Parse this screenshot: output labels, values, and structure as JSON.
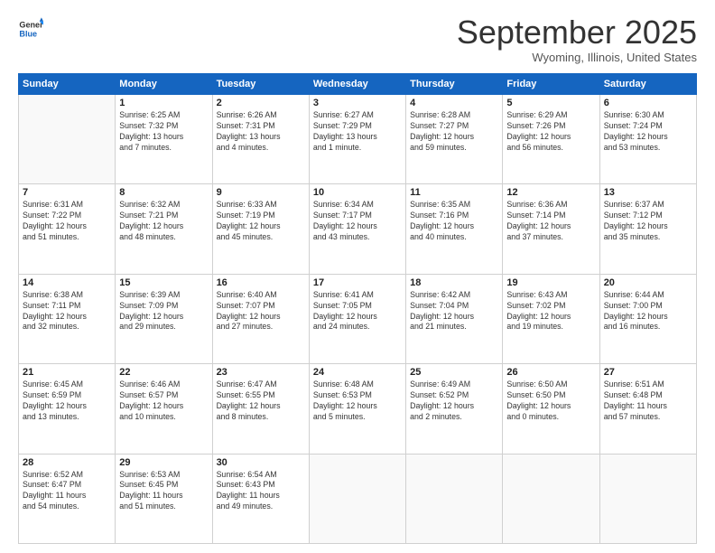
{
  "header": {
    "logo_line1": "General",
    "logo_line2": "Blue",
    "month_title": "September 2025",
    "location": "Wyoming, Illinois, United States"
  },
  "columns": [
    "Sunday",
    "Monday",
    "Tuesday",
    "Wednesday",
    "Thursday",
    "Friday",
    "Saturday"
  ],
  "weeks": [
    [
      {
        "day": "",
        "info": ""
      },
      {
        "day": "1",
        "info": "Sunrise: 6:25 AM\nSunset: 7:32 PM\nDaylight: 13 hours\nand 7 minutes."
      },
      {
        "day": "2",
        "info": "Sunrise: 6:26 AM\nSunset: 7:31 PM\nDaylight: 13 hours\nand 4 minutes."
      },
      {
        "day": "3",
        "info": "Sunrise: 6:27 AM\nSunset: 7:29 PM\nDaylight: 13 hours\nand 1 minute."
      },
      {
        "day": "4",
        "info": "Sunrise: 6:28 AM\nSunset: 7:27 PM\nDaylight: 12 hours\nand 59 minutes."
      },
      {
        "day": "5",
        "info": "Sunrise: 6:29 AM\nSunset: 7:26 PM\nDaylight: 12 hours\nand 56 minutes."
      },
      {
        "day": "6",
        "info": "Sunrise: 6:30 AM\nSunset: 7:24 PM\nDaylight: 12 hours\nand 53 minutes."
      }
    ],
    [
      {
        "day": "7",
        "info": "Sunrise: 6:31 AM\nSunset: 7:22 PM\nDaylight: 12 hours\nand 51 minutes."
      },
      {
        "day": "8",
        "info": "Sunrise: 6:32 AM\nSunset: 7:21 PM\nDaylight: 12 hours\nand 48 minutes."
      },
      {
        "day": "9",
        "info": "Sunrise: 6:33 AM\nSunset: 7:19 PM\nDaylight: 12 hours\nand 45 minutes."
      },
      {
        "day": "10",
        "info": "Sunrise: 6:34 AM\nSunset: 7:17 PM\nDaylight: 12 hours\nand 43 minutes."
      },
      {
        "day": "11",
        "info": "Sunrise: 6:35 AM\nSunset: 7:16 PM\nDaylight: 12 hours\nand 40 minutes."
      },
      {
        "day": "12",
        "info": "Sunrise: 6:36 AM\nSunset: 7:14 PM\nDaylight: 12 hours\nand 37 minutes."
      },
      {
        "day": "13",
        "info": "Sunrise: 6:37 AM\nSunset: 7:12 PM\nDaylight: 12 hours\nand 35 minutes."
      }
    ],
    [
      {
        "day": "14",
        "info": "Sunrise: 6:38 AM\nSunset: 7:11 PM\nDaylight: 12 hours\nand 32 minutes."
      },
      {
        "day": "15",
        "info": "Sunrise: 6:39 AM\nSunset: 7:09 PM\nDaylight: 12 hours\nand 29 minutes."
      },
      {
        "day": "16",
        "info": "Sunrise: 6:40 AM\nSunset: 7:07 PM\nDaylight: 12 hours\nand 27 minutes."
      },
      {
        "day": "17",
        "info": "Sunrise: 6:41 AM\nSunset: 7:05 PM\nDaylight: 12 hours\nand 24 minutes."
      },
      {
        "day": "18",
        "info": "Sunrise: 6:42 AM\nSunset: 7:04 PM\nDaylight: 12 hours\nand 21 minutes."
      },
      {
        "day": "19",
        "info": "Sunrise: 6:43 AM\nSunset: 7:02 PM\nDaylight: 12 hours\nand 19 minutes."
      },
      {
        "day": "20",
        "info": "Sunrise: 6:44 AM\nSunset: 7:00 PM\nDaylight: 12 hours\nand 16 minutes."
      }
    ],
    [
      {
        "day": "21",
        "info": "Sunrise: 6:45 AM\nSunset: 6:59 PM\nDaylight: 12 hours\nand 13 minutes."
      },
      {
        "day": "22",
        "info": "Sunrise: 6:46 AM\nSunset: 6:57 PM\nDaylight: 12 hours\nand 10 minutes."
      },
      {
        "day": "23",
        "info": "Sunrise: 6:47 AM\nSunset: 6:55 PM\nDaylight: 12 hours\nand 8 minutes."
      },
      {
        "day": "24",
        "info": "Sunrise: 6:48 AM\nSunset: 6:53 PM\nDaylight: 12 hours\nand 5 minutes."
      },
      {
        "day": "25",
        "info": "Sunrise: 6:49 AM\nSunset: 6:52 PM\nDaylight: 12 hours\nand 2 minutes."
      },
      {
        "day": "26",
        "info": "Sunrise: 6:50 AM\nSunset: 6:50 PM\nDaylight: 12 hours\nand 0 minutes."
      },
      {
        "day": "27",
        "info": "Sunrise: 6:51 AM\nSunset: 6:48 PM\nDaylight: 11 hours\nand 57 minutes."
      }
    ],
    [
      {
        "day": "28",
        "info": "Sunrise: 6:52 AM\nSunset: 6:47 PM\nDaylight: 11 hours\nand 54 minutes."
      },
      {
        "day": "29",
        "info": "Sunrise: 6:53 AM\nSunset: 6:45 PM\nDaylight: 11 hours\nand 51 minutes."
      },
      {
        "day": "30",
        "info": "Sunrise: 6:54 AM\nSunset: 6:43 PM\nDaylight: 11 hours\nand 49 minutes."
      },
      {
        "day": "",
        "info": ""
      },
      {
        "day": "",
        "info": ""
      },
      {
        "day": "",
        "info": ""
      },
      {
        "day": "",
        "info": ""
      }
    ]
  ]
}
